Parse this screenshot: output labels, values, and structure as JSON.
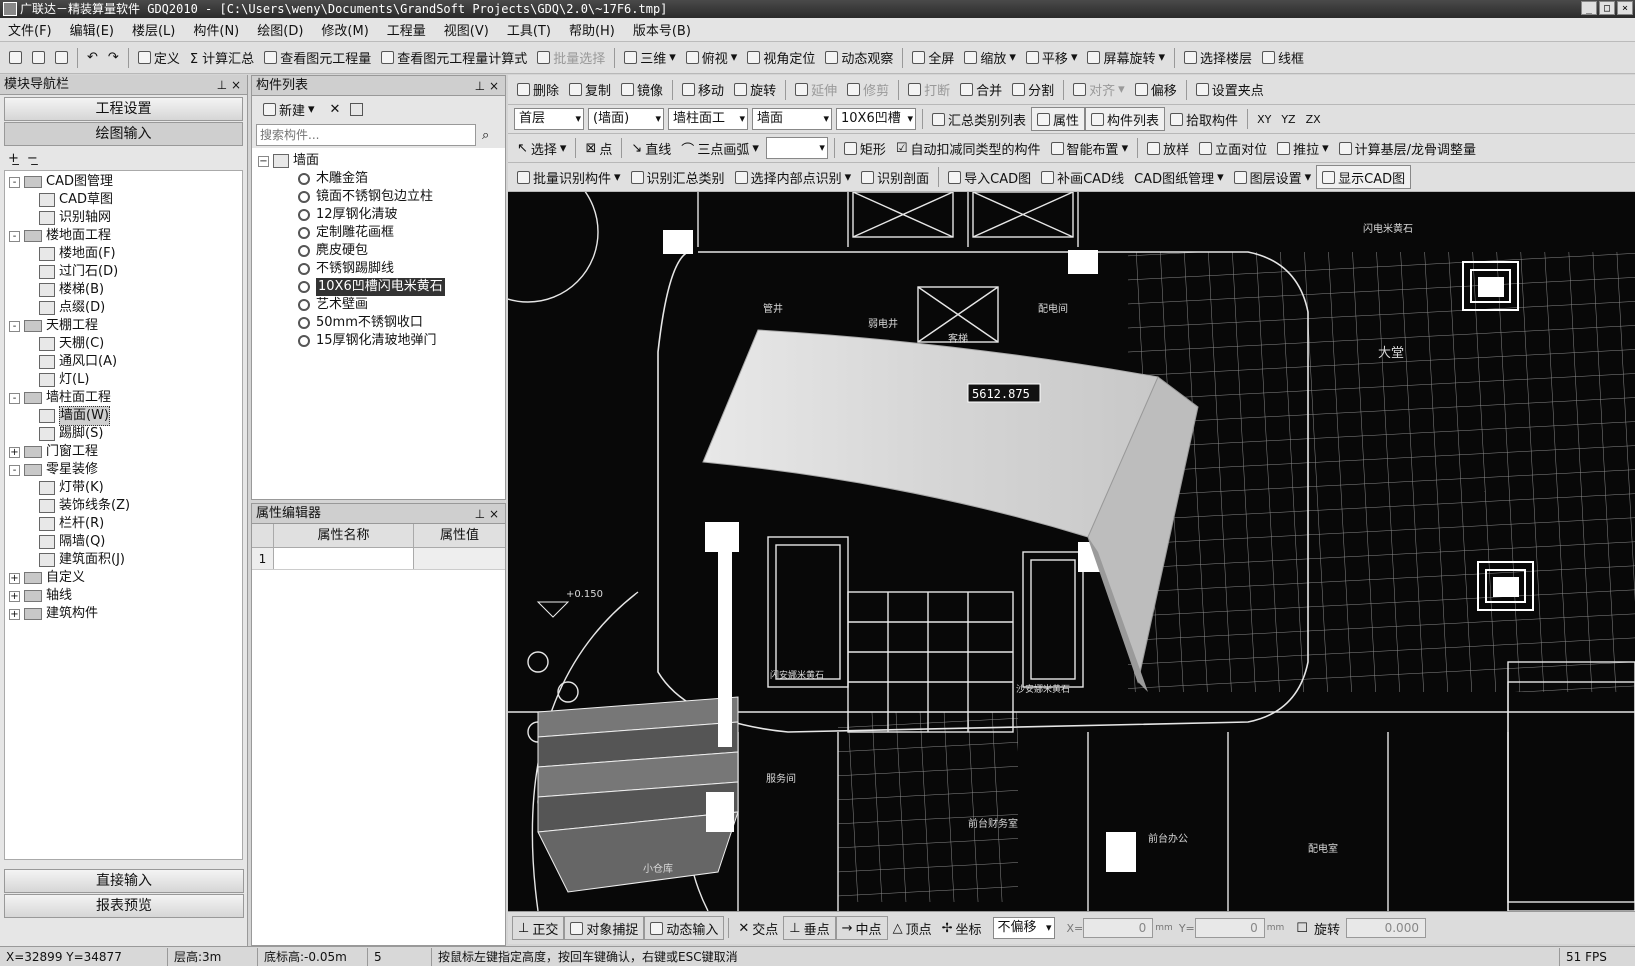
{
  "window": {
    "title": "广联达－精装算量软件 GDQ2010 - [C:\\Users\\weny\\Documents\\GrandSoft Projects\\GDQ\\2.0\\~17F6.tmp]",
    "controls": [
      "_",
      "□",
      "×"
    ]
  },
  "menu": [
    "文件(F)",
    "编辑(E)",
    "楼层(L)",
    "构件(N)",
    "绘图(D)",
    "修改(M)",
    "工程量",
    "视图(V)",
    "工具(T)",
    "帮助(H)",
    "版本号(B)"
  ],
  "toolbar1": [
    "定义",
    "Σ 计算汇总",
    "查看图元工程量",
    "查看图元工程量计算式",
    "批量选择",
    "三维",
    "俯视",
    "视角定位",
    "动态观察",
    "全屏",
    "缩放",
    "平移",
    "屏幕旋转",
    "选择楼层",
    "线框"
  ],
  "nav": {
    "title": "模块导航栏",
    "buttons": [
      "工程设置",
      "绘图输入"
    ],
    "bottom_buttons": [
      "直接输入",
      "报表预览"
    ],
    "tree": [
      {
        "label": "CAD图管理",
        "level": 0,
        "type": "folder",
        "exp": "-"
      },
      {
        "label": "CAD草图",
        "level": 1,
        "type": "leaf"
      },
      {
        "label": "识别轴网",
        "level": 1,
        "type": "leaf"
      },
      {
        "label": "楼地面工程",
        "level": 0,
        "type": "folder",
        "exp": "-"
      },
      {
        "label": "楼地面(F)",
        "level": 1,
        "type": "leaf"
      },
      {
        "label": "过门石(D)",
        "level": 1,
        "type": "leaf"
      },
      {
        "label": "楼梯(B)",
        "level": 1,
        "type": "leaf"
      },
      {
        "label": "点缀(D)",
        "level": 1,
        "type": "leaf"
      },
      {
        "label": "天棚工程",
        "level": 0,
        "type": "folder",
        "exp": "-"
      },
      {
        "label": "天棚(C)",
        "level": 1,
        "type": "leaf"
      },
      {
        "label": "通风口(A)",
        "level": 1,
        "type": "leaf"
      },
      {
        "label": "灯(L)",
        "level": 1,
        "type": "leaf"
      },
      {
        "label": "墙柱面工程",
        "level": 0,
        "type": "folder",
        "exp": "-"
      },
      {
        "label": "墙面(W)",
        "level": 1,
        "type": "leaf",
        "selected": true
      },
      {
        "label": "踢脚(S)",
        "level": 1,
        "type": "leaf"
      },
      {
        "label": "门窗工程",
        "level": 0,
        "type": "folder",
        "exp": "+"
      },
      {
        "label": "零星装修",
        "level": 0,
        "type": "folder",
        "exp": "-"
      },
      {
        "label": "灯带(K)",
        "level": 1,
        "type": "leaf"
      },
      {
        "label": "装饰线条(Z)",
        "level": 1,
        "type": "leaf"
      },
      {
        "label": "栏杆(R)",
        "level": 1,
        "type": "leaf"
      },
      {
        "label": "隔墙(Q)",
        "level": 1,
        "type": "leaf"
      },
      {
        "label": "建筑面积(J)",
        "level": 1,
        "type": "leaf"
      },
      {
        "label": "自定义",
        "level": 0,
        "type": "folder",
        "exp": "+"
      },
      {
        "label": "轴线",
        "level": 0,
        "type": "folder",
        "exp": "+"
      },
      {
        "label": "建筑构件",
        "level": 0,
        "type": "folder",
        "exp": "+"
      }
    ]
  },
  "complist": {
    "title": "构件列表",
    "new_label": "新建",
    "search_placeholder": "搜索构件...",
    "root": "墙面",
    "items": [
      "木雕金箔",
      "镜面不锈钢包边立柱",
      "12厚钢化清玻",
      "定制雕花画框",
      "麂皮硬包",
      "不锈钢踢脚线",
      "10X6凹槽闪电米黄石",
      "艺术壁画",
      "50mm不锈钢收口",
      "15厚钢化清玻地弹门"
    ],
    "selected_index": 6
  },
  "props": {
    "title": "属性编辑器",
    "col_name": "属性名称",
    "col_value": "属性值",
    "row_num": "1"
  },
  "toolbar2": [
    "删除",
    "复制",
    "镜像",
    "移动",
    "旋转",
    "延伸",
    "修剪",
    "打断",
    "合并",
    "分割",
    "对齐",
    "偏移",
    "设置夹点"
  ],
  "toolbar3": {
    "floor": "首层",
    "type": "(墙面)",
    "category": "墙柱面工",
    "sub": "墙面",
    "component": "10X6凹槽",
    "buttons": [
      "汇总类别列表",
      "属性",
      "构件列表",
      "拾取构件",
      "XY",
      "YZ",
      "ZX"
    ]
  },
  "toolbar4": [
    "选择",
    "点",
    "直线",
    "三点画弧",
    "矩形",
    "自动扣减同类型的构件",
    "智能布置",
    "放样",
    "立面对位",
    "推拉",
    "计算基层/龙骨调整量"
  ],
  "toolbar5": [
    "批量识别构件",
    "识别汇总类别",
    "选择内部点识别",
    "识别剖面",
    "导入CAD图",
    "补画CAD线",
    "CAD图纸管理",
    "图层设置",
    "显示CAD图"
  ],
  "canvas": {
    "dimension_input": "5612.875",
    "labels": [
      "闪电米黄石",
      "大堂",
      "管井",
      "弱电井",
      "配电间",
      "客梯",
      "+0.150",
      "小仓库",
      "前台财务室",
      "前台办公",
      "配电室",
      "服务间",
      "闪安娜米黄石",
      "沙安娜米黄石"
    ]
  },
  "snapbar": {
    "buttons": [
      "正交",
      "对象捕捉",
      "动态输入",
      "交点",
      "垂点",
      "中点",
      "顶点",
      "坐标"
    ],
    "offset_mode": "不偏移",
    "x_label": "X=",
    "x_value": "0",
    "y_label": "Y=",
    "y_value": "0",
    "unit": "mm",
    "rotate_label": "旋转",
    "rotate_value": "0.000"
  },
  "status": {
    "coords": "X=32899 Y=34877",
    "floor_height": "层高:3m",
    "base_height": "底标高:-0.05m",
    "count": "5",
    "hint": "按鼠标左键指定高度，按回车键确认，右键或ESC键取消",
    "fps": "51 FPS"
  }
}
